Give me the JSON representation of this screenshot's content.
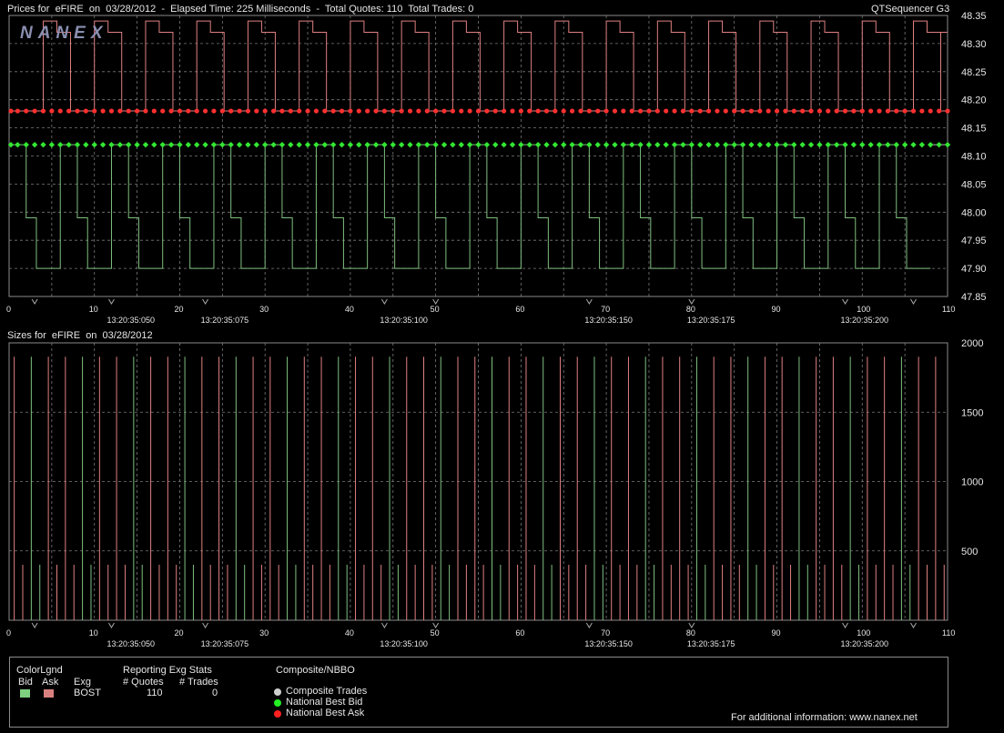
{
  "header": {
    "title": "Prices for  eFIRE  on  03/28/2012  -  Elapsed Time: 225 Milliseconds  -  Total Quotes: 110  Total Trades: 0",
    "app": "QTSequencer G3",
    "sizes_title": "Sizes for  eFIRE  on  03/28/2012",
    "logo": "NANEX"
  },
  "colors": {
    "bid": "#33e633",
    "ask": "#ff3030",
    "bid_line": "#7fbf7f",
    "ask_line": "#e08080",
    "grid": "#7a7a7a"
  },
  "x_axis": {
    "ticks": [
      "0",
      "10",
      "20",
      "30",
      "40",
      "50",
      "60",
      "70",
      "80",
      "90",
      "100",
      "110"
    ],
    "tick_values": [
      0,
      10,
      20,
      30,
      40,
      50,
      60,
      70,
      80,
      90,
      100,
      110
    ],
    "time_labels": [
      {
        "at": 12,
        "label": "13:20:35:050"
      },
      {
        "at": 23,
        "label": "13:20:35:075"
      },
      {
        "at": 44,
        "label": "13:20:35:100"
      },
      {
        "at": 68,
        "label": "13:20:35:150"
      },
      {
        "at": 80,
        "label": "13:20:35:175"
      },
      {
        "at": 98,
        "label": "13:20:35:200"
      }
    ],
    "markers": [
      3,
      12,
      23,
      44,
      50,
      68,
      80,
      98,
      106
    ]
  },
  "chart_data": [
    {
      "type": "line",
      "title": "Prices for  eFIRE  on  03/28/2012",
      "xlim": [
        0,
        110
      ],
      "ylim": [
        47.85,
        48.35
      ],
      "y_ticks": [
        "48.35",
        "48.30",
        "48.25",
        "48.20",
        "48.15",
        "48.10",
        "48.05",
        "48.00",
        "47.95",
        "47.90",
        "47.85"
      ],
      "y_tick_values": [
        48.35,
        48.3,
        48.25,
        48.2,
        48.15,
        48.1,
        48.05,
        48.0,
        47.95,
        47.9,
        47.85
      ],
      "national_best_bid": 48.12,
      "national_best_ask": 48.18,
      "bid_cycle_starts": [
        0,
        6,
        12,
        18,
        24,
        30,
        36,
        42,
        48,
        54,
        60,
        66,
        72,
        78,
        84,
        90,
        96,
        102
      ],
      "bid_cycle_levels": [
        48.12,
        47.99,
        47.9
      ],
      "ask_cycle_starts": [
        4,
        10,
        16,
        22,
        28,
        34,
        40,
        46,
        52,
        58,
        64,
        70,
        76,
        82,
        88,
        94,
        100,
        106
      ],
      "ask_cycle_levels": [
        48.34,
        48.32,
        48.18
      ]
    },
    {
      "type": "bar",
      "title": "Sizes for  eFIRE  on  03/28/2012",
      "xlim": [
        0,
        110
      ],
      "ylim": [
        0,
        2000
      ],
      "y_ticks": [
        "2000",
        "1500",
        "1000",
        "500"
      ],
      "y_tick_values": [
        2000,
        1500,
        1000,
        500
      ],
      "series": [
        {
          "name": "Bid",
          "values_pattern": [
            1900,
            400
          ]
        },
        {
          "name": "Ask",
          "values_pattern": [
            1900,
            400
          ]
        }
      ]
    }
  ],
  "legend": {
    "colorlgnd": "ColorLgnd",
    "bid": "Bid",
    "ask": "Ask",
    "exg": "Exg",
    "exg_value": "BOST",
    "reporting": "Reporting Exg Stats",
    "quotes_hdr": "# Quotes",
    "trades_hdr": "# Trades",
    "quotes": "110",
    "trades": "0",
    "composite": "Composite/NBBO",
    "composite_trades": "Composite Trades",
    "nbb": "National Best Bid",
    "nba": "National Best Ask",
    "info": "For additional information: www.nanex.net"
  }
}
